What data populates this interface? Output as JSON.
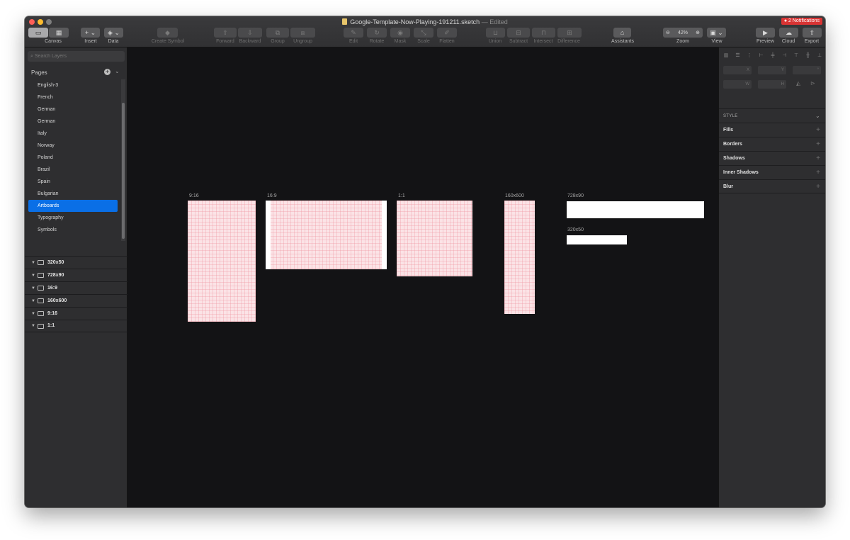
{
  "window": {
    "title": "Google-Template-Now-Playing-191211.sketch",
    "title_suffix": "— Edited",
    "notifications": "● 2 Notifications"
  },
  "toolbar": {
    "canvas": "Canvas",
    "insert": "Insert",
    "data": "Data",
    "create_symbol": "Create Symbol",
    "forward": "Forward",
    "backward": "Backward",
    "group": "Group",
    "ungroup": "Ungroup",
    "edit": "Edit",
    "rotate": "Rotate",
    "mask": "Mask",
    "scale": "Scale",
    "flatten": "Flatten",
    "union": "Union",
    "subtract": "Subtract",
    "intersect": "Intersect",
    "difference": "Difference",
    "assistants": "Assistants",
    "zoom": "Zoom",
    "zoom_value": "42%",
    "view": "View",
    "preview": "Preview",
    "cloud": "Cloud",
    "export": "Export"
  },
  "sidebar": {
    "search_placeholder": "Search Layers",
    "pages_header": "Pages",
    "pages": [
      "English-3",
      "French",
      "German",
      "German",
      "Italy",
      "Norway",
      "Poland",
      "Brazil",
      "Spain",
      "Bulgarian",
      "Artboards",
      "Typography",
      "Symbols"
    ],
    "selected_page": "Artboards",
    "layers": [
      "320x50",
      "728x90",
      "16:9",
      "160x600",
      "9:16",
      "1:1"
    ]
  },
  "canvas": {
    "artboards": [
      "9:16",
      "16:9",
      "1:1",
      "160x600",
      "728x90",
      "320x50"
    ]
  },
  "inspector": {
    "fields": {
      "x": "X",
      "y": "Y",
      "rotation": "°",
      "w": "W",
      "h": "H"
    },
    "style_header": "STYLE",
    "sections": [
      "Fills",
      "Borders",
      "Shadows",
      "Inner Shadows",
      "Blur"
    ]
  }
}
